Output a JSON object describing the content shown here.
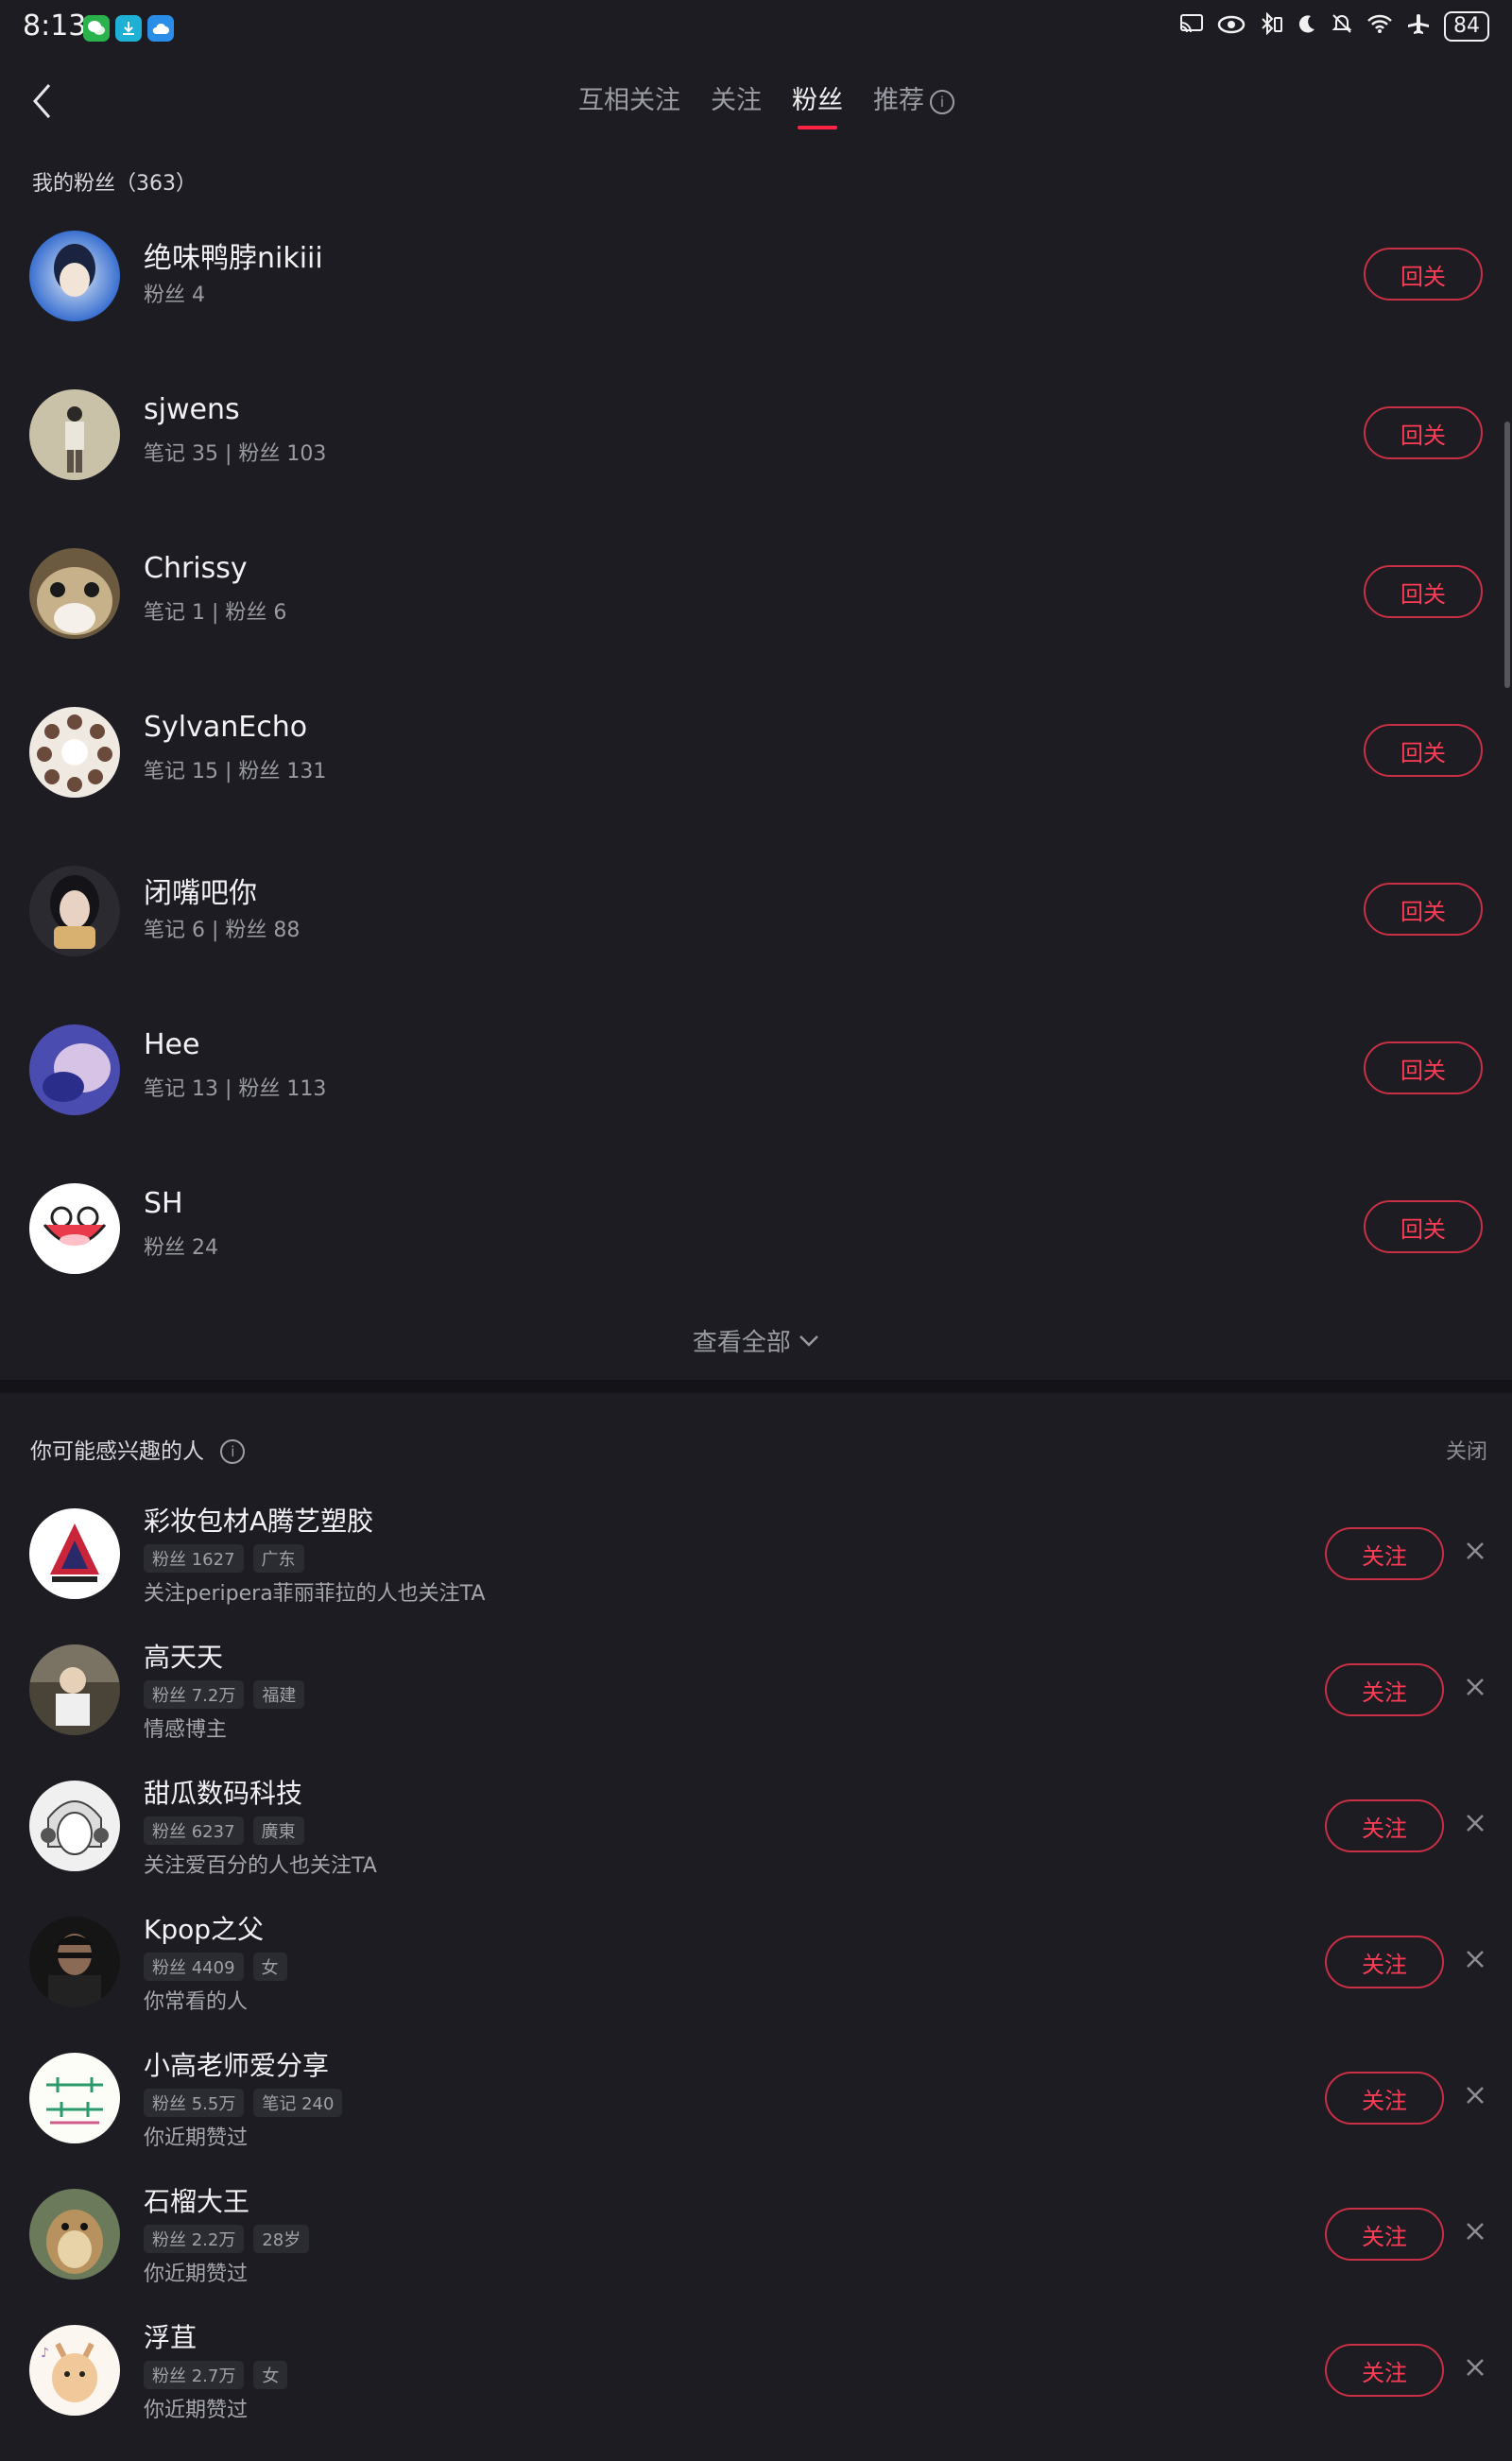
{
  "status_bar": {
    "time": "8:13",
    "app_icons": [
      "wechat-icon",
      "download-icon",
      "cloud-icon"
    ],
    "system_icons": [
      "cast-icon",
      "eye-icon",
      "bluetooth-icon",
      "moon-icon",
      "mute-icon",
      "wifi-icon",
      "airplane-icon"
    ],
    "battery": "84"
  },
  "nav": {
    "tabs": [
      {
        "label": "互相关注"
      },
      {
        "label": "关注"
      },
      {
        "label": "粉丝"
      },
      {
        "label": "推荐"
      }
    ],
    "active_tab": "粉丝"
  },
  "followers": {
    "title": "我的粉丝（363）",
    "button_label": "回关",
    "items": [
      {
        "name": "绝味鸭脖nikiii",
        "stats": "粉丝 4"
      },
      {
        "name": "sjwens",
        "stats": "笔记 35 | 粉丝 103"
      },
      {
        "name": "Chrissy",
        "stats": "笔记 1 | 粉丝 6"
      },
      {
        "name": "SylvanEcho",
        "stats": "笔记 15 | 粉丝 131"
      },
      {
        "name": "闭嘴吧你",
        "stats": "笔记 6 | 粉丝 88"
      },
      {
        "name": "Hee",
        "stats": "笔记 13 | 粉丝 113"
      },
      {
        "name": "SH",
        "stats": "粉丝 24"
      }
    ],
    "view_all": "查看全部"
  },
  "recommended": {
    "title": "你可能感兴趣的人",
    "close_label": "关闭",
    "button_label": "关注",
    "items": [
      {
        "name": "彩妆包材A腾艺塑胶",
        "tags": [
          "粉丝 1627",
          "广东"
        ],
        "reason": "关注peripera菲丽菲拉的人也关注TA"
      },
      {
        "name": "高天天",
        "tags": [
          "粉丝 7.2万",
          "福建"
        ],
        "reason": "情感博主"
      },
      {
        "name": "甜瓜数码科技",
        "tags": [
          "粉丝 6237",
          "廣東"
        ],
        "reason": "关注爱百分的人也关注TA"
      },
      {
        "name": "Kpop之父",
        "tags": [
          "粉丝 4409",
          "女"
        ],
        "reason": "你常看的人"
      },
      {
        "name": "小高老师爱分享",
        "tags": [
          "粉丝 5.5万",
          "笔记 240"
        ],
        "reason": "你近期赞过"
      },
      {
        "name": "石榴大王",
        "tags": [
          "粉丝 2.2万",
          "28岁"
        ],
        "reason": "你近期赞过"
      },
      {
        "name": "浮苴",
        "tags": [
          "粉丝 2.7万",
          "女"
        ],
        "reason": "你近期赞过"
      }
    ]
  },
  "colors": {
    "accent": "#ff2442",
    "background": "#1c1c22"
  }
}
